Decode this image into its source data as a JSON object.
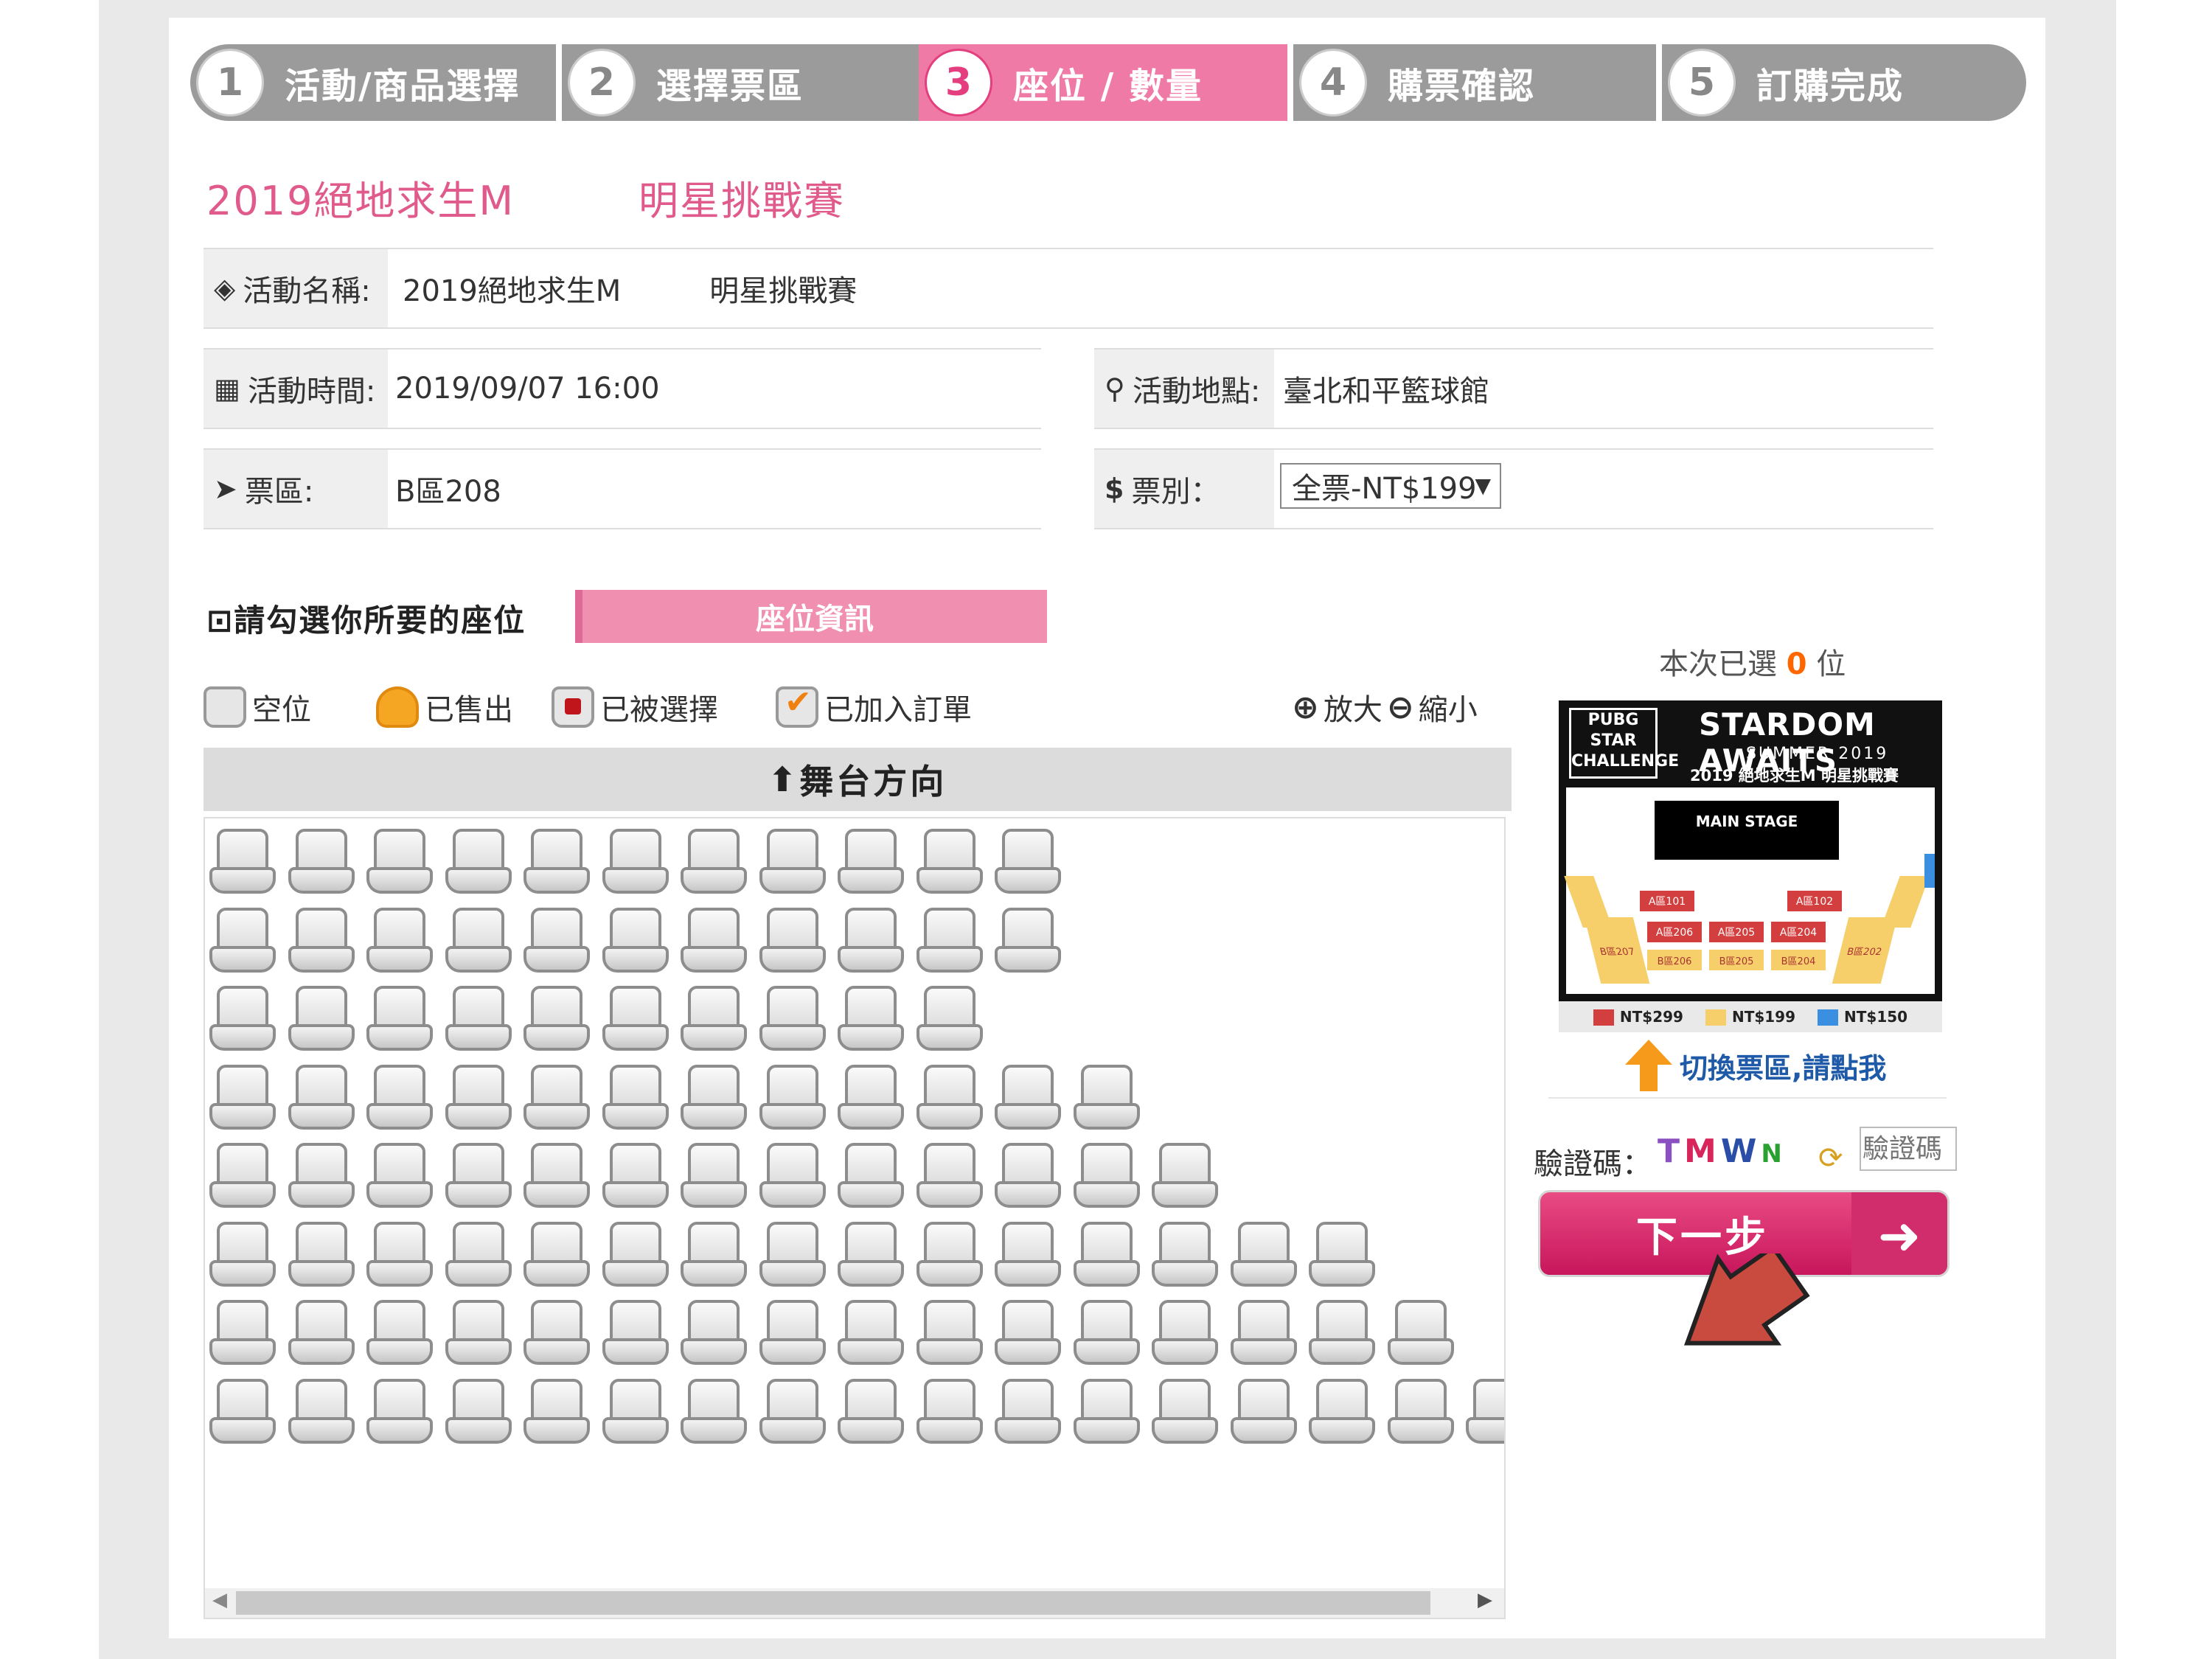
{
  "steps": [
    {
      "num": "1",
      "label": "活動/商品選擇"
    },
    {
      "num": "2",
      "label": "選擇票區"
    },
    {
      "num": "3",
      "label": "座位 / 數量"
    },
    {
      "num": "4",
      "label": "購票確認"
    },
    {
      "num": "5",
      "label": "訂購完成"
    }
  ],
  "active_step": 3,
  "title": "2019絕地求生M　　　明星挑戰賽",
  "info": {
    "event_name_label": "活動名稱:",
    "event_name": "2019絕地求生M　　　明星挑戰賽",
    "time_label": "活動時間:",
    "time": "2019/09/07 16:00",
    "place_label": "活動地點:",
    "place": "臺北和平籃球館",
    "area_label": "票區:",
    "area": "B區208",
    "ticket_type_label": "票別：",
    "ticket_type": "全票-NT$199"
  },
  "choose_text": "請勾選你所要的座位",
  "seat_info_button": "座位資訊",
  "legend": {
    "empty": "空位",
    "sold": "已售出",
    "picked": "已被選擇",
    "added": "已加入訂單"
  },
  "zoom": {
    "in": "放大",
    "out": "縮小"
  },
  "stage_direction": "舞台方向",
  "seat_rows": [
    11,
    11,
    10,
    12,
    13,
    15,
    16,
    17
  ],
  "selected": {
    "prefix": "本次已選",
    "count": "0",
    "suffix": "位"
  },
  "minimap": {
    "heading": "STARDOM AWAITS",
    "sub": "SUMMER 2019",
    "event": "2019 絕地求生M 明星挑戰賽",
    "badge": "PUBG STAR CHALLENGE",
    "stage": "MAIN STAGE",
    "zones_red": [
      "A區101",
      "A區102",
      "A區206",
      "A區205",
      "A區204"
    ],
    "zones_yellow": [
      "B區206",
      "B區205",
      "B區204",
      "B區207",
      "B區202"
    ],
    "legend": [
      "NT$299",
      "NT$199",
      "NT$150"
    ],
    "colors": {
      "red": "#d33f3f",
      "yellow": "#f6cf6a",
      "blue": "#3a8fe0"
    }
  },
  "switch_text": "切換票區,請點我",
  "captcha": {
    "label": "驗證碼：",
    "image_text": "TMWN",
    "placeholder": "驗證碼"
  },
  "next_button": "下一步",
  "colors": {
    "accent": "#e43e7e",
    "active_step": "#f07aa6",
    "steps_bar": "#9b9b9b"
  }
}
